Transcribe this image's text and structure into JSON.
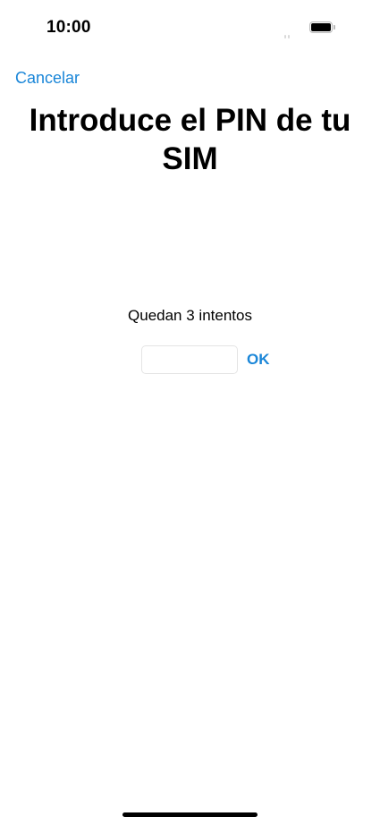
{
  "status_bar": {
    "time": "10:00",
    "battery_level": 1.0,
    "icons": [
      "signal-icon",
      "battery-icon"
    ]
  },
  "nav": {
    "cancel_label": "Cancelar"
  },
  "title": "Introduce el PIN de tu SIM",
  "attempts_text": "Quedan 3 intentos",
  "pin_field": {
    "value": "",
    "placeholder": ""
  },
  "ok_label": "OK",
  "colors": {
    "accent": "#1a86d8",
    "text": "#000000",
    "background": "#ffffff"
  }
}
